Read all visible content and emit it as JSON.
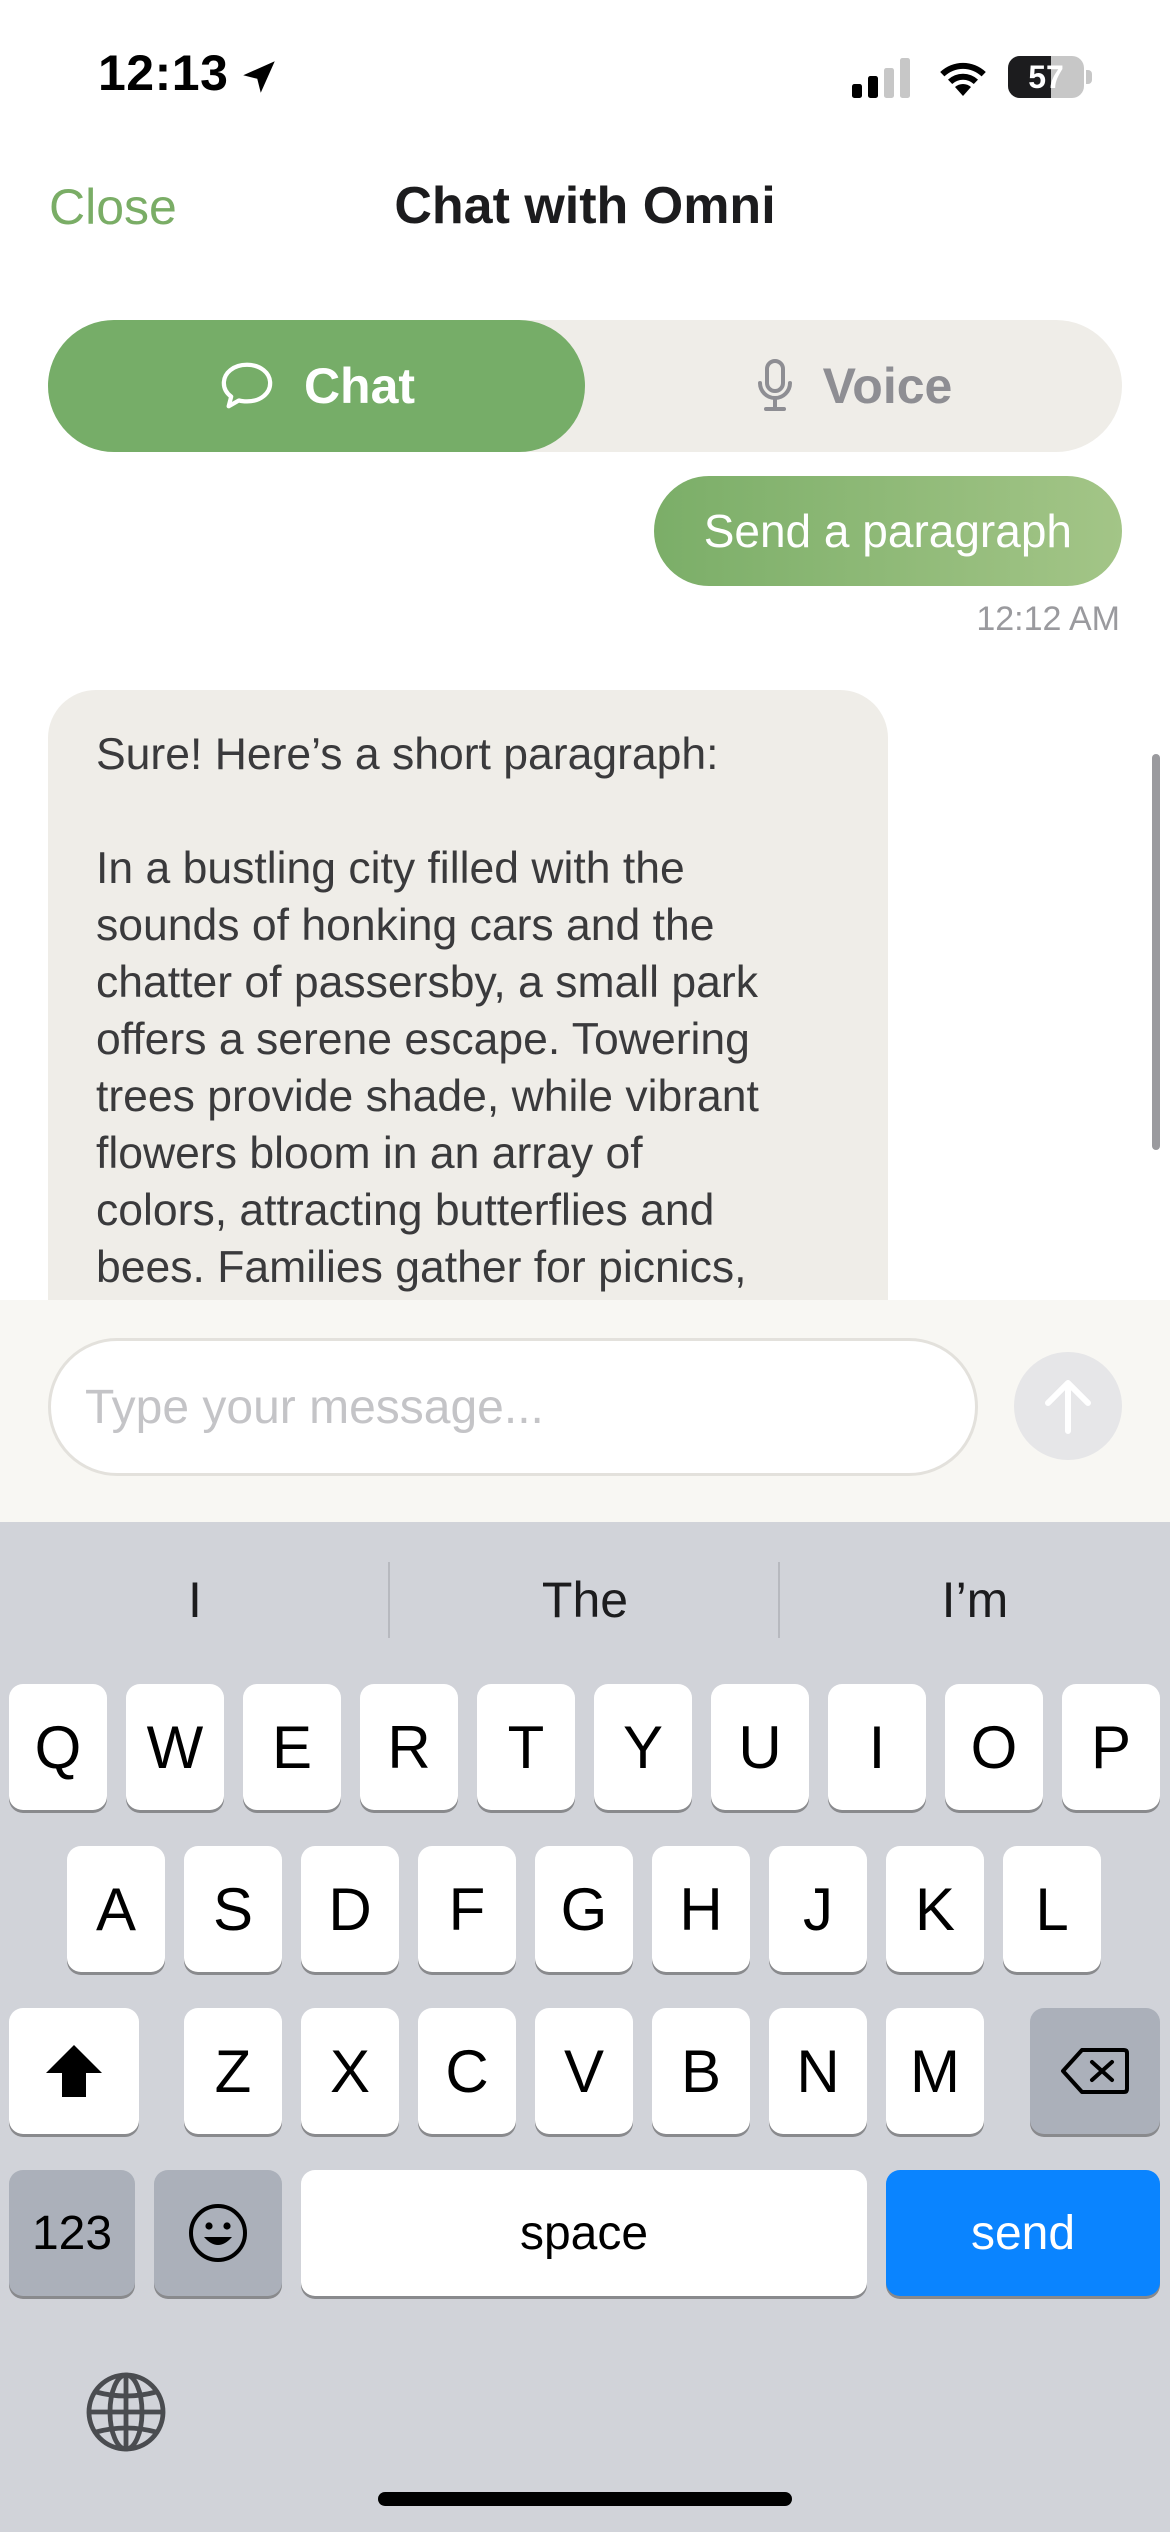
{
  "status_bar": {
    "time": "12:13",
    "battery_level": "57",
    "icons": [
      "location-arrow-icon",
      "cellular-signal-icon",
      "wifi-icon",
      "battery-icon"
    ]
  },
  "nav": {
    "close_label": "Close",
    "title": "Chat with Omni"
  },
  "segmented": {
    "chat_label": "Chat",
    "voice_label": "Voice",
    "selected": "Chat",
    "chat_icon": "chat-bubble-icon",
    "voice_icon": "microphone-icon"
  },
  "messages": [
    {
      "role": "user",
      "text": "Send a paragraph",
      "time": "12:12 AM"
    },
    {
      "role": "assistant",
      "intro": "Sure! Here’s a short paragraph:",
      "paragraph_lines": [
        "In a bustling city filled with the",
        "sounds of honking cars and the",
        "chatter of passersby, a small park",
        "offers a serene escape. Towering",
        "trees provide shade, while vibrant",
        "flowers bloom in an array of",
        "colors, attracting butterflies and",
        "bees. Families gather for picnics,"
      ]
    }
  ],
  "composer": {
    "placeholder": "Type your message...",
    "value": "",
    "send_icon": "arrow-up-icon"
  },
  "keyboard": {
    "suggestions": [
      "I",
      "The",
      "I’m"
    ],
    "row1": [
      "Q",
      "W",
      "E",
      "R",
      "T",
      "Y",
      "U",
      "I",
      "O",
      "P"
    ],
    "row2": [
      "A",
      "S",
      "D",
      "F",
      "G",
      "H",
      "J",
      "K",
      "L"
    ],
    "row3": [
      "Z",
      "X",
      "C",
      "V",
      "B",
      "N",
      "M"
    ],
    "numbers_label": "123",
    "space_label": "space",
    "send_label": "send",
    "icons": [
      "shift-icon",
      "backspace-icon",
      "emoji-icon",
      "globe-icon"
    ]
  },
  "colors": {
    "accent_green": "#76ad68",
    "send_blue": "#0a84ff",
    "bubble_gray": "#efede8"
  }
}
